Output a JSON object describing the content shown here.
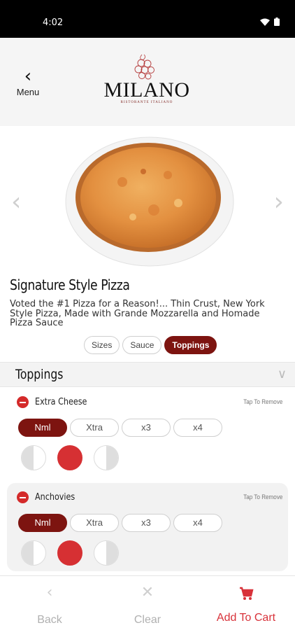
{
  "status_bar": {
    "time": "4:02"
  },
  "header": {
    "menu_label": "Menu",
    "logo_text": "MILANO",
    "logo_subtext": "RISTORANTE ITALIANO"
  },
  "product": {
    "title": "Signature Style Pizza",
    "description": "Voted the #1 Pizza for a Reason!... Thin Crust, New York Style Pizza, Made with Grande Mozzarella and Homade Pizza Sauce"
  },
  "tabs": [
    {
      "label": "Sizes"
    },
    {
      "label": "Sauce"
    },
    {
      "label": "Toppings"
    }
  ],
  "toppings_section": {
    "title": "Toppings",
    "items": [
      {
        "name": "Extra Cheese",
        "action": "Tap To Remove",
        "amounts": [
          "Nml",
          "Xtra",
          "x3",
          "x4"
        ],
        "selected_amount": "Nml"
      },
      {
        "name": "Anchovies",
        "action": "Tap To Remove",
        "amounts": [
          "Nml",
          "Xtra",
          "x3",
          "x4"
        ],
        "selected_amount": "Nml"
      }
    ]
  },
  "bottom_bar": {
    "back_label": "Back",
    "clear_label": "Clear",
    "cart_label": "Add To Cart"
  },
  "colors": {
    "accent": "#7d1410",
    "cart": "#d8323a",
    "remove": "#d42a2a"
  }
}
